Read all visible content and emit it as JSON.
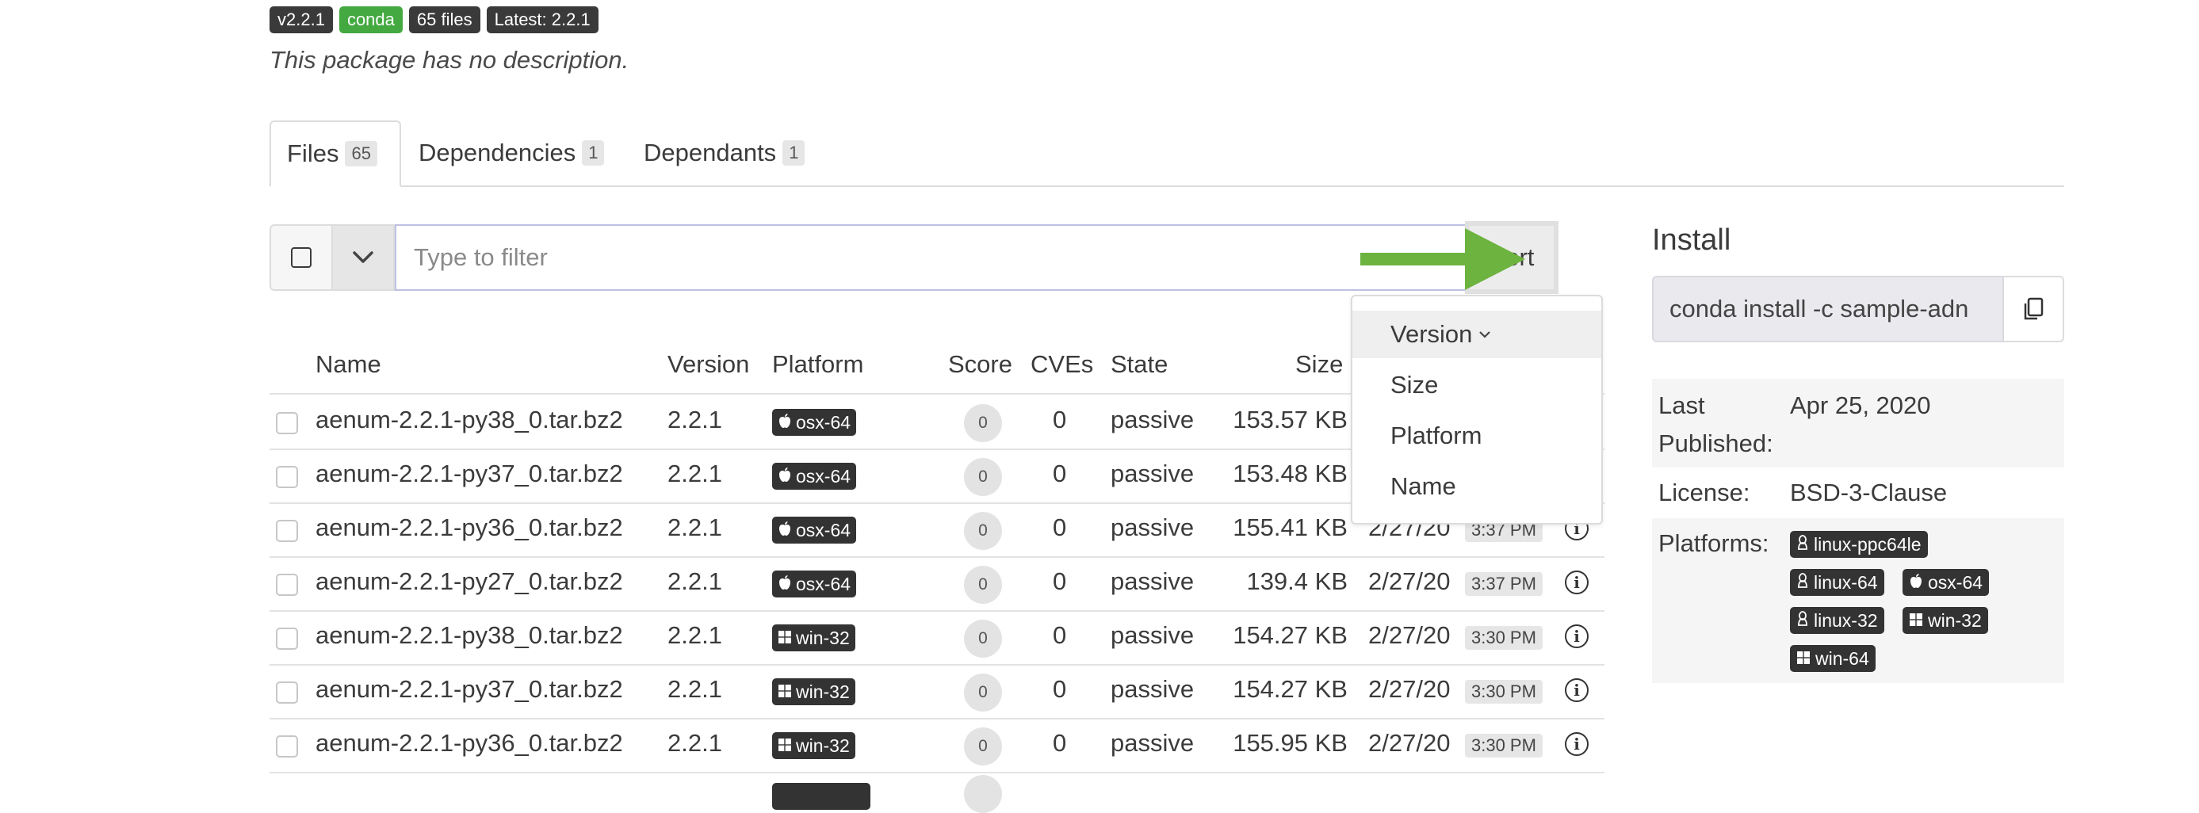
{
  "badges": {
    "version": "v2.2.1",
    "channel": "conda",
    "files": "65 files",
    "latest": "Latest: 2.2.1"
  },
  "description": "This package has no description.",
  "tabs": [
    {
      "label": "Files",
      "count": "65"
    },
    {
      "label": "Dependencies",
      "count": "1"
    },
    {
      "label": "Dependants",
      "count": "1"
    }
  ],
  "filter": {
    "placeholder": "Type to filter",
    "sort_label": "Sort"
  },
  "sort_menu": {
    "items": [
      "Version",
      "Size",
      "Platform",
      "Name"
    ],
    "selected": "Version"
  },
  "table": {
    "headers": {
      "name": "Name",
      "version": "Version",
      "platform": "Platform",
      "score": "Score",
      "cves": "CVEs",
      "state": "State",
      "size": "Size"
    },
    "rows": [
      {
        "name": "aenum-2.2.1-py38_0.tar.bz2",
        "version": "2.2.1",
        "platform": "osx-64",
        "score": "0",
        "cves": "0",
        "state": "passive",
        "size": "153.57 KB",
        "date": "",
        "time": ""
      },
      {
        "name": "aenum-2.2.1-py37_0.tar.bz2",
        "version": "2.2.1",
        "platform": "osx-64",
        "score": "0",
        "cves": "0",
        "state": "passive",
        "size": "153.48 KB",
        "date": "",
        "time": ""
      },
      {
        "name": "aenum-2.2.1-py36_0.tar.bz2",
        "version": "2.2.1",
        "platform": "osx-64",
        "score": "0",
        "cves": "0",
        "state": "passive",
        "size": "155.41 KB",
        "date": "2/27/20",
        "time": "3:37 PM"
      },
      {
        "name": "aenum-2.2.1-py27_0.tar.bz2",
        "version": "2.2.1",
        "platform": "osx-64",
        "score": "0",
        "cves": "0",
        "state": "passive",
        "size": "139.4 KB",
        "date": "2/27/20",
        "time": "3:37 PM"
      },
      {
        "name": "aenum-2.2.1-py38_0.tar.bz2",
        "version": "2.2.1",
        "platform": "win-32",
        "score": "0",
        "cves": "0",
        "state": "passive",
        "size": "154.27 KB",
        "date": "2/27/20",
        "time": "3:30 PM"
      },
      {
        "name": "aenum-2.2.1-py37_0.tar.bz2",
        "version": "2.2.1",
        "platform": "win-32",
        "score": "0",
        "cves": "0",
        "state": "passive",
        "size": "154.27 KB",
        "date": "2/27/20",
        "time": "3:30 PM"
      },
      {
        "name": "aenum-2.2.1-py36_0.tar.bz2",
        "version": "2.2.1",
        "platform": "win-32",
        "score": "0",
        "cves": "0",
        "state": "passive",
        "size": "155.95 KB",
        "date": "2/27/20",
        "time": "3:30 PM"
      }
    ]
  },
  "install": {
    "title": "Install",
    "command": "conda install -c sample-adn",
    "last_published_label": "Last Published:",
    "last_published_label_line1": "Last",
    "last_published_label_line2": "Published:",
    "last_published": "Apr 25, 2020",
    "license_label": "License:",
    "license": "BSD-3-Clause",
    "platforms_label": "Platforms:",
    "platforms": [
      "linux-ppc64le",
      "linux-64",
      "osx-64",
      "linux-32",
      "win-32",
      "win-64"
    ]
  },
  "colors": {
    "arrow": "#6db33f",
    "conda_badge": "#43a940",
    "dark_badge": "#333333"
  }
}
